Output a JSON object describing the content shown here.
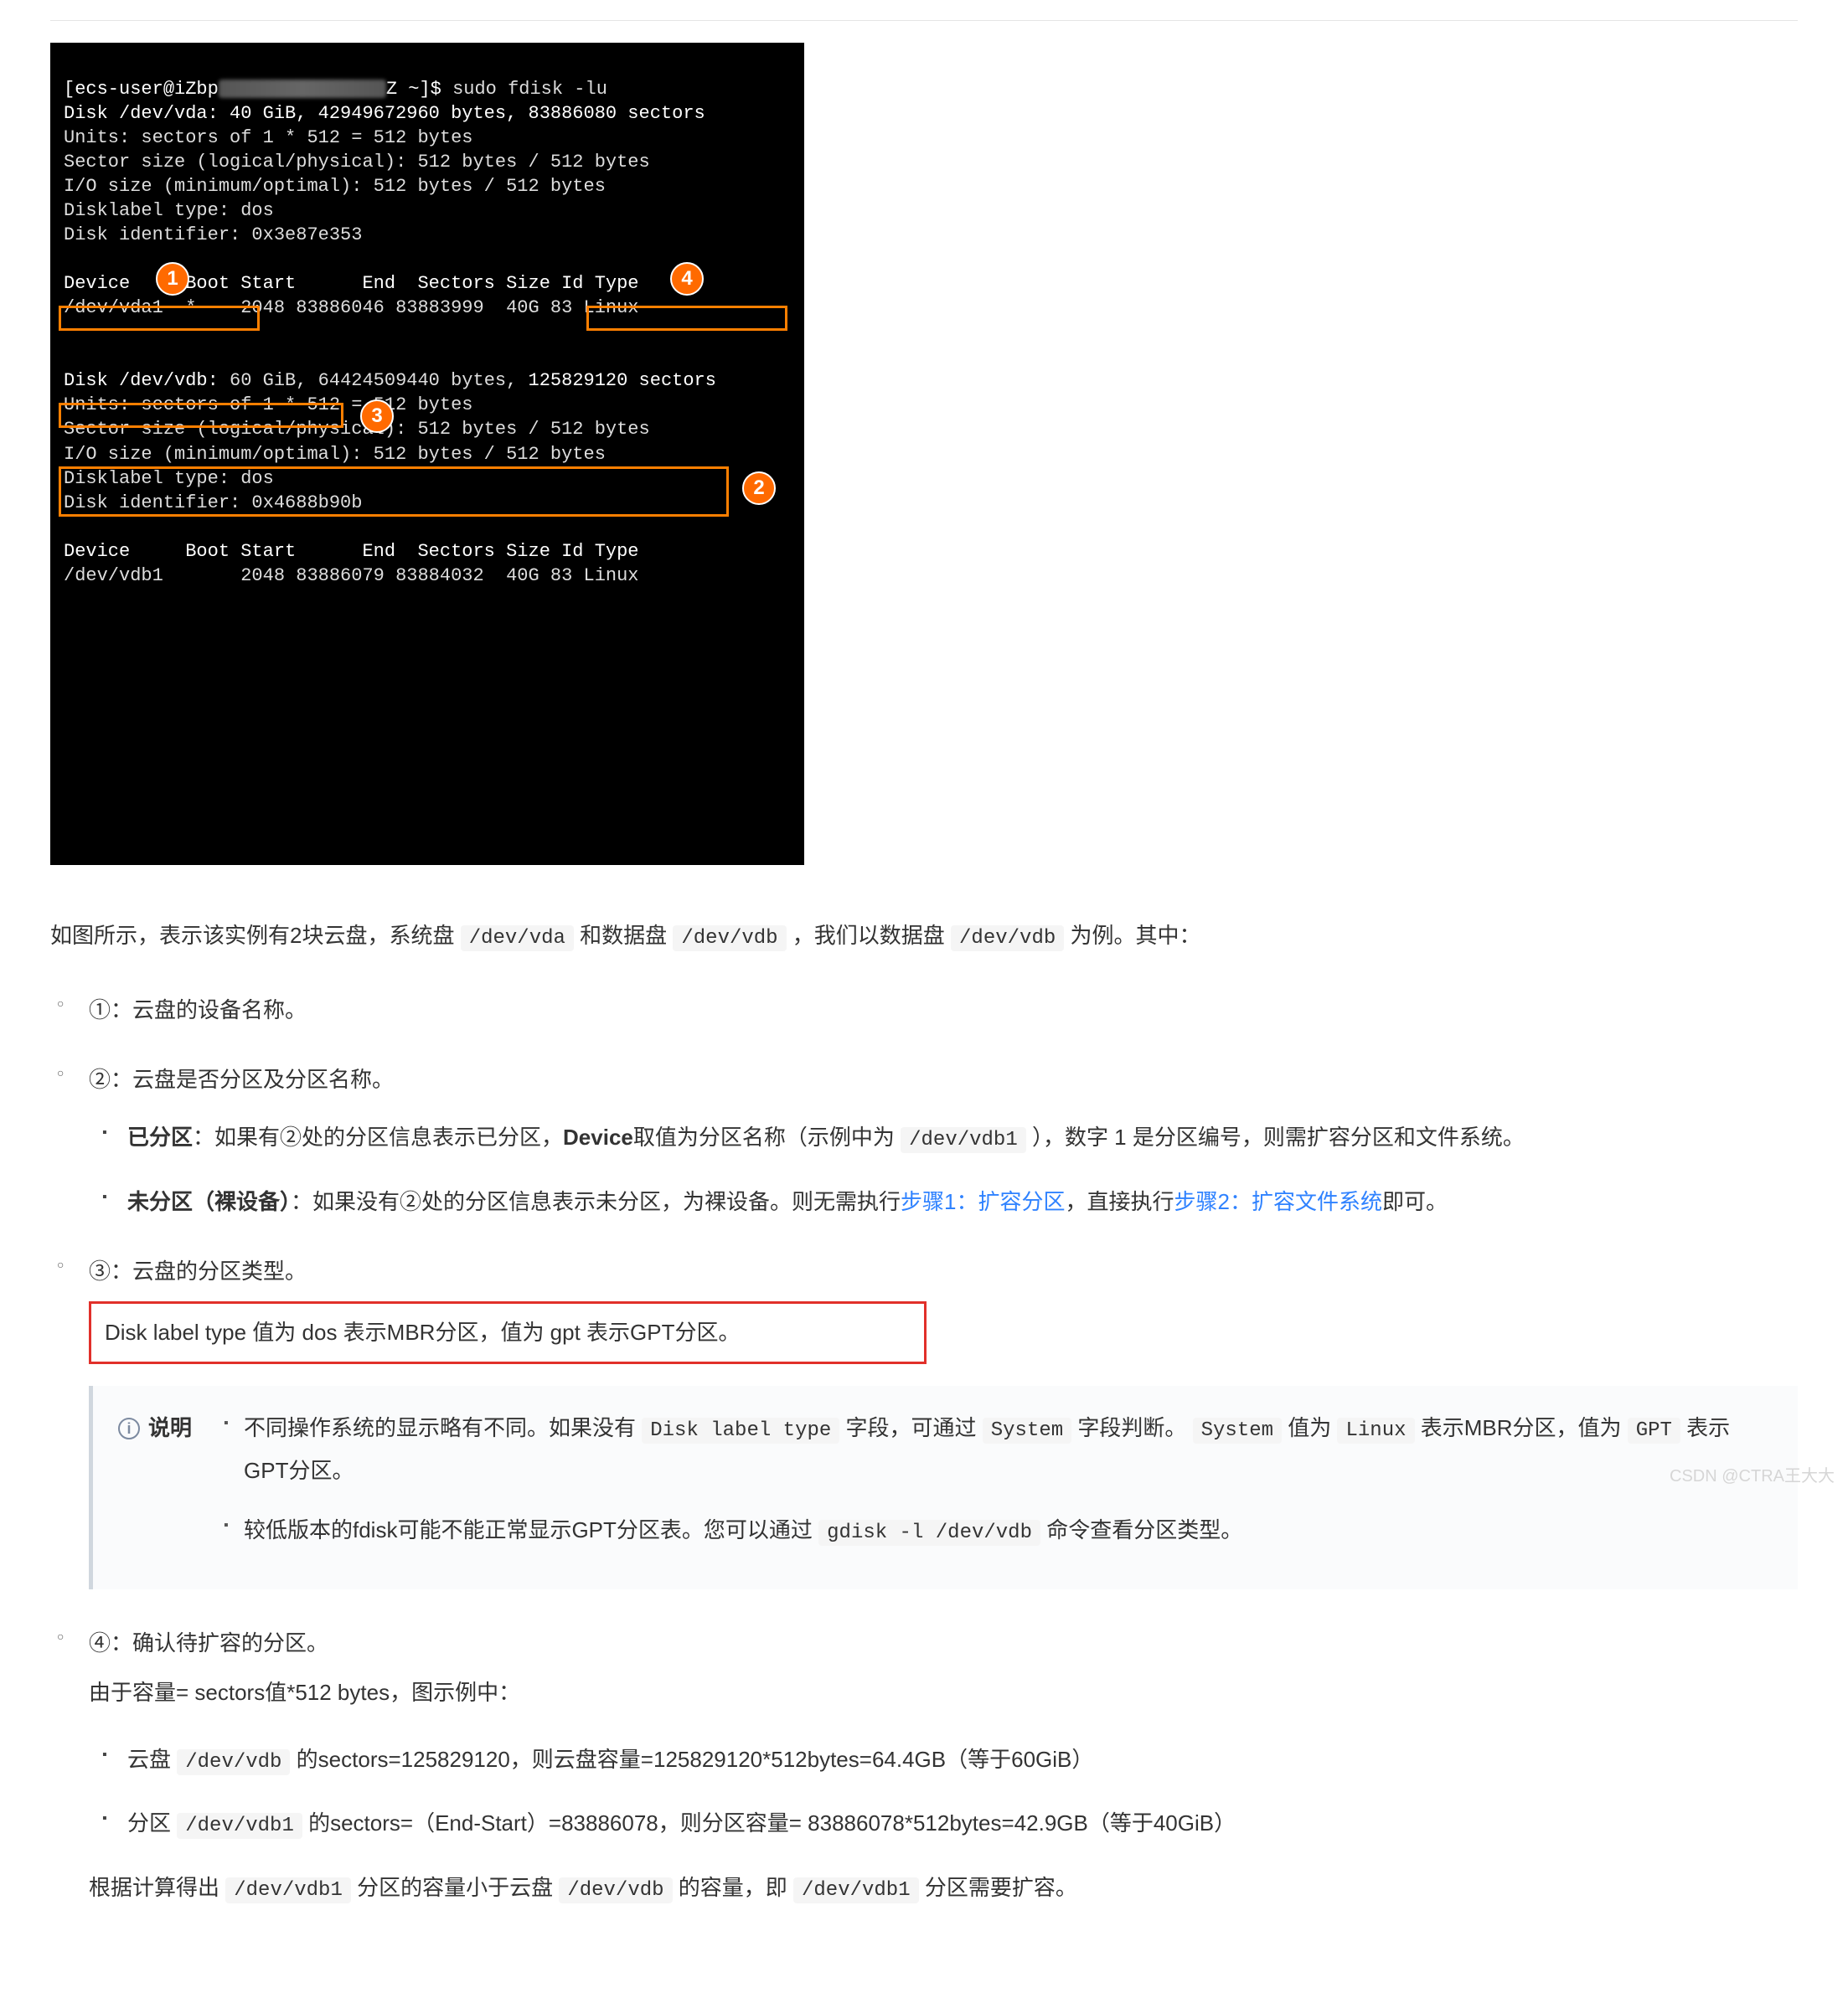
{
  "terminal": {
    "prompt_prefix": "[ecs-user@iZbp",
    "prompt_suffix": "Z ~]$ ",
    "cmd": "sudo fdisk -lu",
    "vda_disk": "Disk /dev/vda: 40 GiB, 42949672960 bytes, 83886080 sectors",
    "units": "Units: sectors of 1 * 512 = 512 bytes",
    "sector_size": "Sector size (logical/physical): 512 bytes / 512 bytes",
    "io_size": "I/O size (minimum/optimal): 512 bytes / 512 bytes",
    "dl_type": "Disklabel type: dos",
    "disk_id_a": "Disk identifier: 0x3e87e353",
    "hdr": "Device     Boot Start      End  Sectors Size Id Type",
    "vda1": "/dev/vda1  *    2048 83886046 83883999  40G 83 Linux",
    "vdb_prefix": "Disk /dev/vdb:",
    "vdb_mid": " 60 GiB, 64424509440 bytes, ",
    "vdb_sectors": "125829120 sectors",
    "disklabel_box": "Disklabel type: dos ",
    "disk_id_b": "Disk identifier: 0x4688b90b",
    "hdr2": "Device     Boot Start      End  Sectors Size Id Type",
    "vdb1": "/dev/vdb1       2048 83886079 83884032  40G 83 Linux"
  },
  "badges": {
    "b1": "1",
    "b2": "2",
    "b3": "3",
    "b4": "4"
  },
  "p_intro_a": "如图所示，表示该实例有2块云盘，系统盘 ",
  "p_intro_code1": "/dev/vda",
  "p_intro_b": " 和数据盘 ",
  "p_intro_code2": "/dev/vdb",
  "p_intro_c": " ，我们以数据盘 ",
  "p_intro_code3": "/dev/vdb",
  "p_intro_d": " 为例。其中：",
  "li1": "①：云盘的设备名称。",
  "li2": "②：云盘是否分区及分区名称。",
  "li2a_bold": "已分区",
  "li2a_a": "：如果有②处的分区信息表示已分区，",
  "li2a_bold2": "Device",
  "li2a_b": "取值为分区名称（示例中为 ",
  "li2a_code": "/dev/vdb1",
  "li2a_c": " ），数字 1 是分区编号，则需扩容分区和文件系统。",
  "li2b_bold": "未分区（裸设备）",
  "li2b_a": "：如果没有②处的分区信息表示未分区，为裸设备。则无需执行",
  "li2b_link1": "步骤1：扩容分区",
  "li2b_b": "，直接执行",
  "li2b_link2": "步骤2：扩容文件系统",
  "li2b_c": "即可。",
  "li3": "③：云盘的分区类型。",
  "li3_box": "Disk label type 值为 dos 表示MBR分区，值为 gpt 表示GPT分区。",
  "note_title": "说明",
  "note1_a": "不同操作系统的显示略有不同。如果没有 ",
  "note1_code1": "Disk label type",
  "note1_b": " 字段，可通过 ",
  "note1_code2": "System",
  "note1_c": " 字段判断。 ",
  "note1_code3": "System",
  "note1_d": " 值为 ",
  "note1_code4": "Linux",
  "note1_e": " 表示MBR分区，值为 ",
  "note1_code5": "GPT",
  "note1_f": " 表示GPT分区。",
  "note2_a": "较低版本的fdisk可能不能正常显示GPT分区表。您可以通过 ",
  "note2_code": "gdisk -l /dev/vdb",
  "note2_b": " 命令查看分区类型。",
  "li4": "④：确认待扩容的分区。",
  "li4_sub": "由于容量= sectors值*512 bytes，图示例中：",
  "li4a_a": "云盘 ",
  "li4a_code": "/dev/vdb",
  "li4a_b": " 的sectors=125829120，则云盘容量=125829120*512bytes=64.4GB（等于60GiB）",
  "li4b_a": "分区 ",
  "li4b_code": "/dev/vdb1",
  "li4b_b": " 的sectors=（End-Start）=83886078，则分区容量= 83886078*512bytes=42.9GB（等于40GiB）",
  "conclusion_a": "根据计算得出 ",
  "conclusion_code1": "/dev/vdb1",
  "conclusion_b": " 分区的容量小于云盘 ",
  "conclusion_code2": "/dev/vdb",
  "conclusion_c": " 的容量，即 ",
  "conclusion_code3": "/dev/vdb1",
  "conclusion_d": " 分区需要扩容。",
  "watermark": "CSDN @CTRA王大大"
}
